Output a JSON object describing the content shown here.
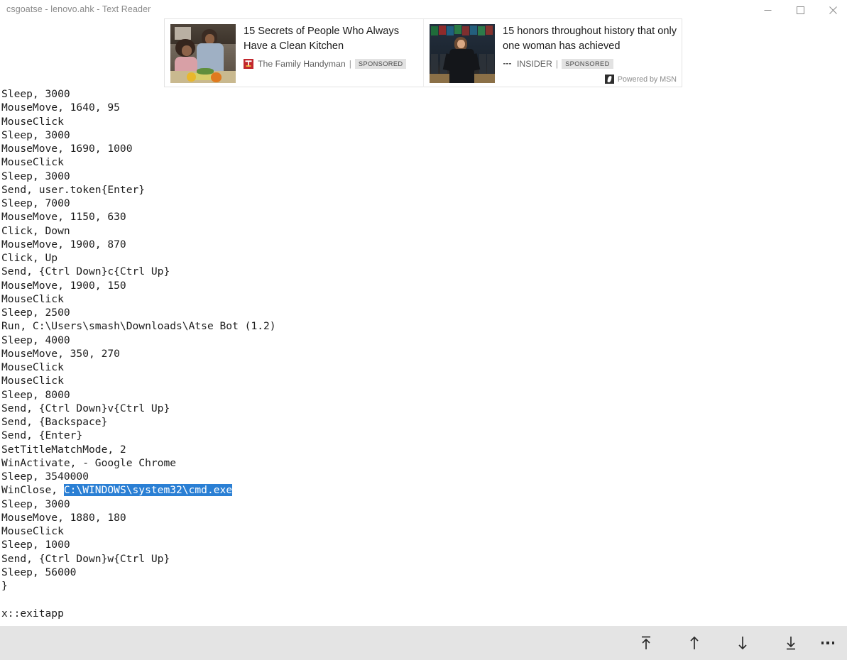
{
  "window": {
    "title": "csgoatse - lenovo.ahk - Text Reader",
    "controls": [
      {
        "name": "minimize",
        "label": "Minimize"
      },
      {
        "name": "maximize",
        "label": "Maximize"
      },
      {
        "name": "close",
        "label": "Close"
      }
    ]
  },
  "ad_banner": {
    "powered_by": "Powered by MSN",
    "powered_by_icon": "msn-logo-icon",
    "cards": [
      {
        "title": "15 Secrets of People Who Always Have a Clean Kitchen",
        "publisher": "The Family Handyman",
        "publisher_icon": "family-handyman-logo-icon",
        "separator": "|",
        "badge": "SPONSORED",
        "thumbnail": "woman-and-child-in-kitchen-thumbnail"
      },
      {
        "title": "15 honors throughout history that only one woman has achieved",
        "publisher": "INSIDER",
        "publisher_icon": "insider-logo-icon",
        "separator": "|",
        "badge": "SPONSORED",
        "thumbnail": "woman-on-trading-floor-thumbnail"
      }
    ]
  },
  "document": {
    "selection_color": "#2a7fd4",
    "selection_text": "C:\\WINDOWS\\system32\\cmd.exe",
    "lines": [
      "Sleep, 3000",
      "MouseMove, 1640, 95",
      "MouseClick",
      "Sleep, 3000",
      "MouseMove, 1690, 1000",
      "MouseClick",
      "Sleep, 3000",
      "Send, user.token{Enter}",
      "Sleep, 7000",
      "MouseMove, 1150, 630",
      "Click, Down",
      "MouseMove, 1900, 870",
      "Click, Up",
      "Send, {Ctrl Down}c{Ctrl Up}",
      "MouseMove, 1900, 150",
      "MouseClick",
      "Sleep, 2500",
      "Run, C:\\Users\\smash\\Downloads\\Atse Bot (1.2)",
      "Sleep, 4000",
      "MouseMove, 350, 270",
      "MouseClick",
      "MouseClick",
      "Sleep, 8000",
      "Send, {Ctrl Down}v{Ctrl Up}",
      "Send, {Backspace}",
      "Send, {Enter}",
      "SetTitleMatchMode, 2",
      "WinActivate, - Google Chrome",
      "Sleep, 3540000",
      "__SELECTED__",
      "Sleep, 3000",
      "MouseMove, 1880, 180",
      "MouseClick",
      "Sleep, 1000",
      "Send, {Ctrl Down}w{Ctrl Up}",
      "Sleep, 56000",
      "}",
      "",
      "x::exitapp"
    ],
    "selected_line_prefix": "WinClose, "
  },
  "toolbar": {
    "buttons": [
      {
        "name": "scroll-to-top-button",
        "icon": "arrow-up-to-line-icon",
        "label": "Top"
      },
      {
        "name": "scroll-up-button",
        "icon": "arrow-up-icon",
        "label": "Up"
      },
      {
        "name": "scroll-down-button",
        "icon": "arrow-down-icon",
        "label": "Down"
      },
      {
        "name": "scroll-to-bottom-button",
        "icon": "arrow-down-to-line-icon",
        "label": "Bottom"
      },
      {
        "name": "more-options-button",
        "icon": "ellipsis-icon",
        "label": "More"
      }
    ]
  }
}
